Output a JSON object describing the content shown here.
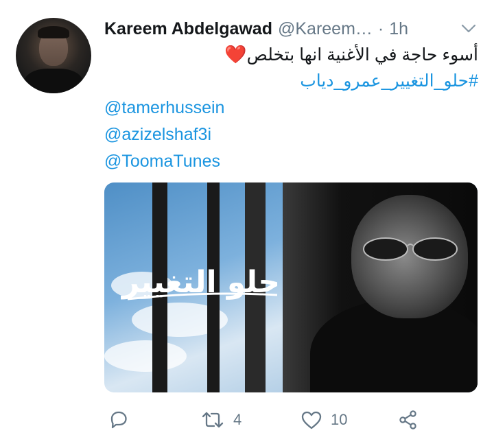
{
  "tweet": {
    "author_name": "Kareem Abdelgawad",
    "author_handle": "@Kareem…",
    "separator": "·",
    "time": "1h",
    "text_line1": "أسوء حاجة في الأغنية انها بتخلص",
    "heart_emoji": "❤️",
    "hashtag": "#حلو_التغيير_عمرو_دياب",
    "mentions": [
      "@tamerhussein",
      "@azizelshaf3i",
      "@ToomaTunes"
    ],
    "media_calligraphy": "حلو التغيير"
  },
  "actions": {
    "reply_icon": "reply-icon",
    "retweet_icon": "retweet-icon",
    "retweet_count": "4",
    "like_icon": "heart-icon",
    "like_count": "10",
    "share_icon": "share-icon"
  },
  "colors": {
    "link": "#1b95e0",
    "secondary_text": "#657786",
    "heart": "#e0245e"
  }
}
